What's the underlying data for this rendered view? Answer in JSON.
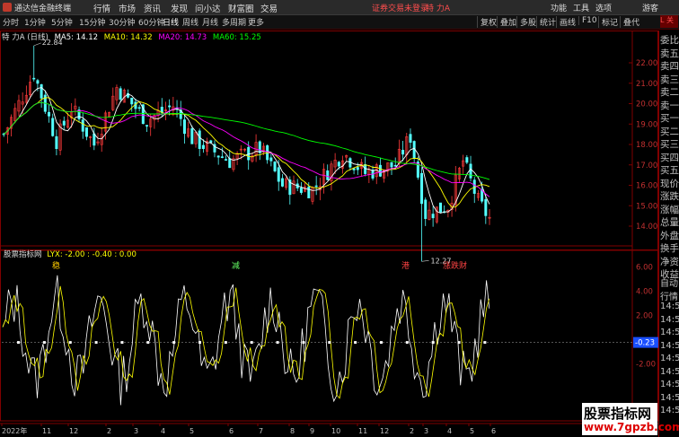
{
  "app": {
    "name": "通达信金融终端",
    "login_status": "证券交易未登录",
    "title_stock": "特 力A"
  },
  "menu": [
    "行情",
    "市场",
    "资讯",
    "发现",
    "问小达",
    "财富圈",
    "交易"
  ],
  "title_right_menu": [
    "功能",
    "工具",
    "选项",
    "游客"
  ],
  "periods": [
    "分时",
    "1分钟",
    "5分钟",
    "15分钟",
    "30分钟",
    "60分钟",
    "日线",
    "周线",
    "月线",
    "多周期",
    "更多"
  ],
  "active_period": "日线",
  "right_toolbar": [
    "叠代",
    "画线",
    "F10",
    "标记"
  ],
  "extra_toolbar": [
    "复权",
    "叠加",
    "多股",
    "统计"
  ],
  "main_header": {
    "stock": "特 力A (日线)",
    "ma5": "MA5: 14.12",
    "ma10": "MA10: 14.32",
    "ma20": "MA20: 14.73",
    "ma60": "MA60: 15.25"
  },
  "sub_header": {
    "name": "股票指标网",
    "formula": "LYX: -2.00 : -0.40 : 0.00"
  },
  "annotations": {
    "high": "22.84",
    "low": "12.27"
  },
  "markers": [
    "稳",
    "减",
    "港",
    "涨跌财"
  ],
  "price_axis": [
    "22.00",
    "21.00",
    "20.00",
    "19.00",
    "18.00",
    "17.00",
    "16.00",
    "15.00",
    "14.00"
  ],
  "ind_axis": [
    "6.00",
    "4.00",
    "2.00",
    "-0.23",
    "-2.00"
  ],
  "date_axis": [
    "2022年",
    "11",
    "12",
    "2",
    "3",
    "4",
    "5",
    "6",
    "7",
    "8",
    "9",
    "10",
    "11",
    "12",
    "2",
    "3",
    "4",
    "5",
    "6"
  ],
  "right_panel": [
    "委比",
    "卖五",
    "卖四",
    "卖三",
    "卖二",
    "卖一",
    "买一",
    "买二",
    "买三",
    "买四",
    "买五",
    "现价",
    "涨跌",
    "涨幅",
    "总量",
    "外盘",
    "换手",
    "净资",
    "收益"
  ],
  "right_panel_lower": [
    "自动",
    "行情",
    "14:5",
    "14:5",
    "14:5",
    "14:5",
    "14:5",
    "14:5",
    "14:5",
    "14:5",
    "14:5"
  ],
  "badge": "L 关",
  "watermark": {
    "line1": "股票指标网",
    "line2": "www.7gpzb.com"
  },
  "colors": {
    "ma5": "#ffffff",
    "ma10": "#ffff00",
    "ma20": "#ff00ff",
    "ma60": "#00ff00",
    "up": "#ff3b3b",
    "down": "#54ffff",
    "axis": "#800000"
  }
}
